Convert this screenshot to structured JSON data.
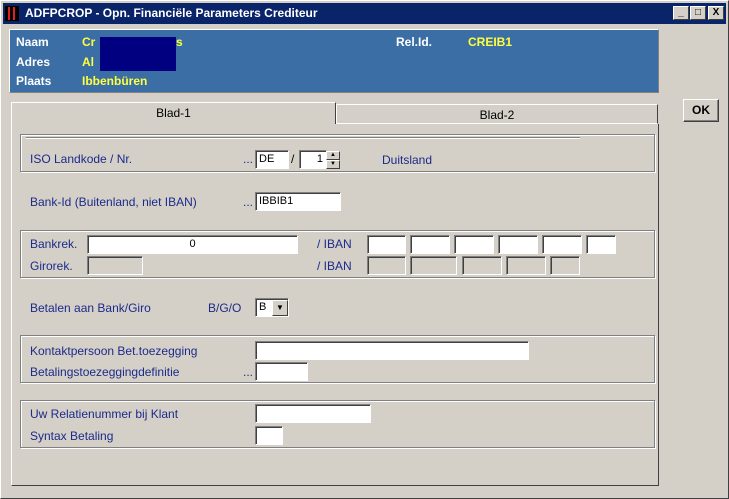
{
  "window": {
    "title": "ADFPCROP - Opn. Financiële Parameters Crediteur",
    "minimize_glyph": "_",
    "maximize_glyph": "□",
    "close_glyph": "X"
  },
  "header": {
    "naam_label": "Naam",
    "naam_value_start": "Cr",
    "naam_value_end": "s",
    "adres_label": "Adres",
    "adres_value_start": "Al",
    "plaats_label": "Plaats",
    "plaats_value": "Ibbenbüren",
    "relid_label": "Rel.Id.",
    "relid_value": "CREIB1"
  },
  "ok_button": "OK",
  "tabs": [
    "Blad-1",
    "Blad-2"
  ],
  "iso": {
    "label": "ISO Landkode / Nr.",
    "dots": "...",
    "country_code": "DE",
    "separator": "/",
    "number": "1",
    "country_name": "Duitsland"
  },
  "bankid": {
    "label": "Bank-Id (Buitenland, niet IBAN)",
    "dots": "...",
    "value": "IBBIB1"
  },
  "bankrek": {
    "label": "Bankrek.",
    "value": "0",
    "iban_label": "/ IBAN"
  },
  "girorek": {
    "label": "Girorek.",
    "iban_label": "/ IBAN"
  },
  "betalen": {
    "label": "Betalen aan Bank/Giro",
    "bgo_label": "B/G/O",
    "selected": "B"
  },
  "kontakt": {
    "label": "Kontaktpersoon Bet.toezegging",
    "value": ""
  },
  "betdef": {
    "label": "Betalingstoezeggingdefinitie",
    "dots": "...",
    "value": ""
  },
  "relnr": {
    "label": "Uw Relatienummer bij Klant",
    "value": ""
  },
  "syntax": {
    "label": "Syntax Betaling",
    "value": ""
  }
}
